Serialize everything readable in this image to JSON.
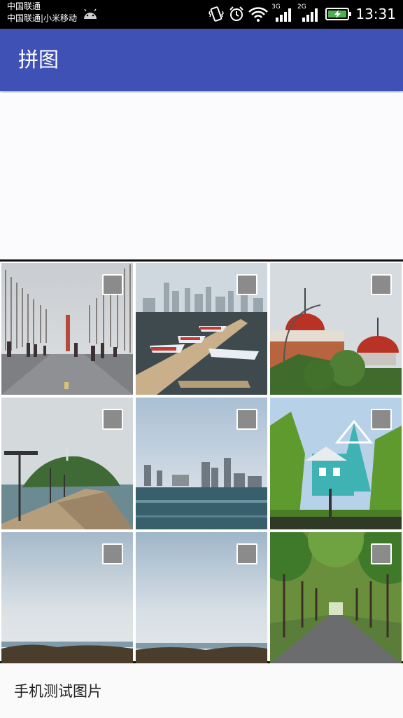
{
  "status_bar": {
    "carrier_line1": "中国联通",
    "carrier_line2": "中国联通|小米移动",
    "net1": "3G",
    "net2": "2G",
    "time": "13:31",
    "icons": [
      "android-icon",
      "vibrate-icon",
      "alarm-icon",
      "wifi-icon",
      "signal-icon",
      "signal-icon",
      "battery-charging-icon"
    ]
  },
  "app_bar": {
    "title": "拼图"
  },
  "grid": {
    "photos": [
      {
        "name": "photo-flag-plaza"
      },
      {
        "name": "photo-marina"
      },
      {
        "name": "photo-red-domes"
      },
      {
        "name": "photo-breakwater-island"
      },
      {
        "name": "photo-city-skyline"
      },
      {
        "name": "photo-teal-house"
      },
      {
        "name": "photo-sky-shore-1"
      },
      {
        "name": "photo-sky-shore-2"
      },
      {
        "name": "photo-tree-road"
      }
    ],
    "checkbox_color": "#8b8b8b"
  },
  "footer": {
    "label": "手机测试图片"
  },
  "colors": {
    "app_bar": "#3f51b5",
    "status_bar": "#000000",
    "battery": "#4caf50"
  }
}
